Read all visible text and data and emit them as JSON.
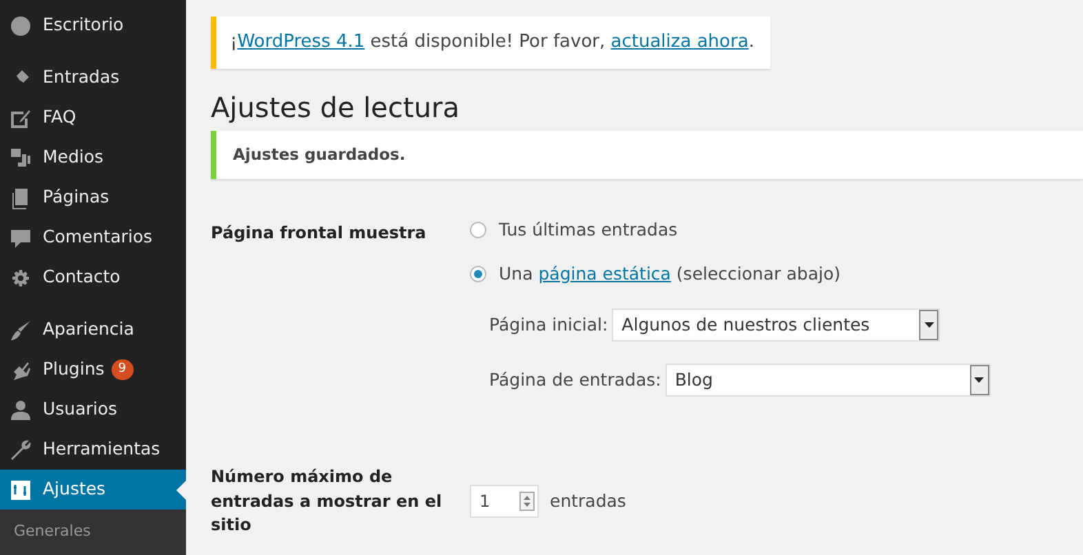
{
  "sidebar": {
    "groups": [
      {
        "items": [
          {
            "label": "Escritorio",
            "selected": false
          }
        ]
      },
      {
        "items": [
          {
            "label": "Entradas",
            "selected": false
          },
          {
            "label": "FAQ",
            "selected": false
          },
          {
            "label": "Medios",
            "selected": false
          },
          {
            "label": "Páginas",
            "selected": false
          },
          {
            "label": "Comentarios",
            "selected": false
          },
          {
            "label": "Contacto",
            "selected": false
          }
        ]
      },
      {
        "items": [
          {
            "label": "Apariencia",
            "selected": false
          },
          {
            "label": "Plugins",
            "selected": false,
            "badge": "9"
          },
          {
            "label": "Usuarios",
            "selected": false
          },
          {
            "label": "Herramientas",
            "selected": false
          },
          {
            "label": "Ajustes",
            "selected": true,
            "submenu": [
              {
                "label": "Generales",
                "selected": false
              }
            ]
          }
        ]
      }
    ]
  },
  "update_notice": {
    "text": "¡",
    "link": "WordPress 4.1",
    "text_2": " está disponible! Por favor, ",
    "link_2": "actualiza ahora",
    "text_3": "."
  },
  "title": "Ajustes de lectura",
  "saved_notice": "Ajustes guardados.",
  "form": {
    "front_page": {
      "label": "Página frontal muestra",
      "options": [
        {
          "kind": "plain",
          "label": "Tus últimas entradas",
          "selected": false
        },
        {
          "kind": "link",
          "label": "Una ",
          "link": "página estática",
          "label_2": " (seleccionar abajo)",
          "selected": true
        }
      ],
      "selects": [
        {
          "label": "Página inicial:",
          "value": "Algunos de nuestros clientes"
        },
        {
          "label": "Página de entradas:",
          "value": "Blog"
        }
      ]
    },
    "posts_per_page": {
      "label": "Número máximo de entradas a mostrar en el sitio",
      "value": "1",
      "unit": "entradas"
    }
  }
}
